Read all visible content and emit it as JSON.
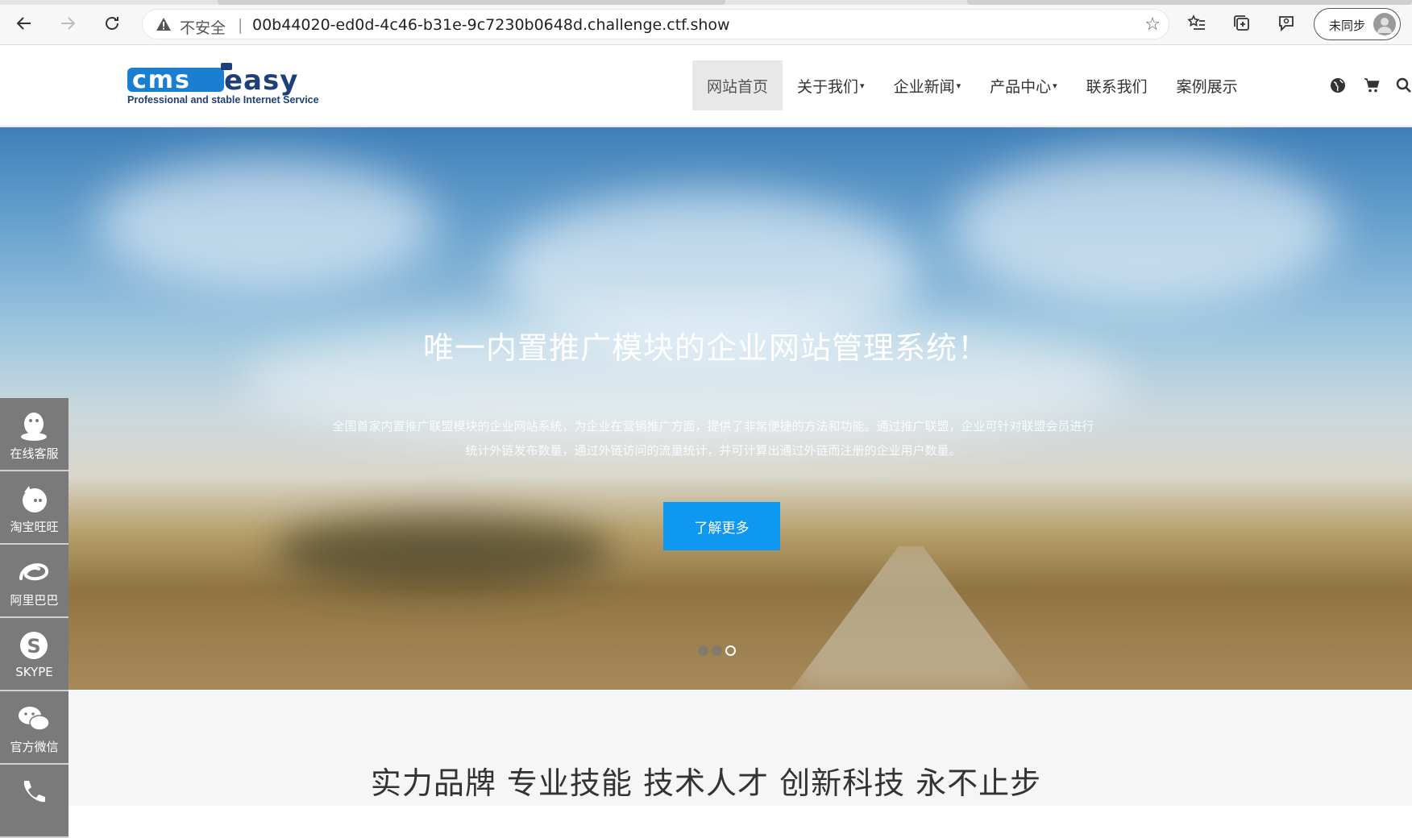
{
  "browser": {
    "insecure_label": "不安全",
    "separator": "|",
    "url": "00b44020-ed0d-4c46-b31e-9c7230b0648d.challenge.ctf.show",
    "sync_label": "未同步"
  },
  "site": {
    "nav": [
      {
        "label": "网站首页",
        "dropdown": false,
        "active": true
      },
      {
        "label": "关于我们",
        "dropdown": true,
        "active": false
      },
      {
        "label": "企业新闻",
        "dropdown": true,
        "active": false
      },
      {
        "label": "产品中心",
        "dropdown": true,
        "active": false
      },
      {
        "label": "联系我们",
        "dropdown": false,
        "active": false
      },
      {
        "label": "案例展示",
        "dropdown": false,
        "active": false
      }
    ],
    "logo_alt_tagline": "Professional and stable Internet Service"
  },
  "hero": {
    "title": "唯一内置推广模块的企业网站管理系统！",
    "description": "全国首家内置推广联盟模块的企业网站系统，为企业在营销推广方面，提供了非常便捷的方法和功能。通过推广联盟，企业可针对联盟会员进行统计外链发布数量，通过外链访问的流量统计，并可计算出通过外链而注册的企业用户数量。",
    "button": "了解更多",
    "slide_count": 3,
    "active_slide": 3
  },
  "section": {
    "slogan": "实力品牌 专业技能 技术人才 创新科技 永不止步"
  },
  "sidebar": {
    "items": [
      {
        "label": "在线客服",
        "icon": "qq-icon"
      },
      {
        "label": "淘宝旺旺",
        "icon": "wangwang-icon"
      },
      {
        "label": "阿里巴巴",
        "icon": "alibaba-icon"
      },
      {
        "label": "SKYPE",
        "icon": "skype-icon"
      },
      {
        "label": "官方微信",
        "icon": "wechat-icon"
      },
      {
        "label": "",
        "icon": "phone-icon"
      }
    ]
  },
  "colors": {
    "accent_button": "#0f98f0",
    "sidebar_bg": "#7a7a7a",
    "logo_blue": "#1a7fd0",
    "logo_dark": "#1d3f7a"
  }
}
